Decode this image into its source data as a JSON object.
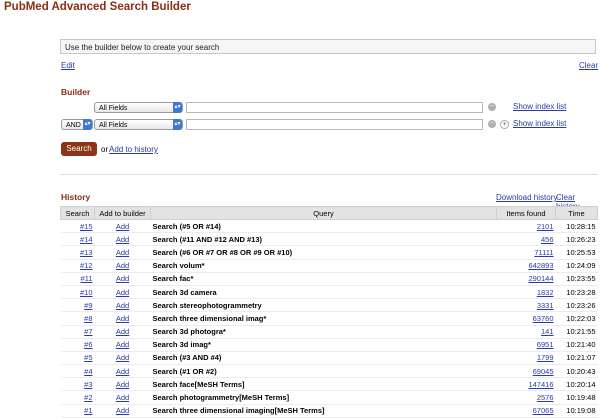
{
  "page": {
    "title": "PubMed Advanced Search Builder"
  },
  "query_box": {
    "placeholder": "Use the builder below to create your search"
  },
  "links": {
    "edit": "Edit",
    "clear": "Clear"
  },
  "builder": {
    "heading": "Builder",
    "rows": [
      {
        "field": "All Fields",
        "show_index": "Show index list"
      },
      {
        "op": "AND",
        "field": "All Fields",
        "show_index": "Show index list"
      }
    ],
    "search_label": "Search",
    "or_text": "or",
    "add_to_history": "Add to history"
  },
  "history": {
    "heading": "History",
    "download": "Download history",
    "clear": "Clear history",
    "columns": [
      "Search",
      "Add to builder",
      "Query",
      "Items found",
      "Time"
    ],
    "rows": [
      {
        "id": "#15",
        "add": "Add",
        "query": "Search (#5 OR #14)",
        "items": "2101",
        "time": "10:28:15"
      },
      {
        "id": "#14",
        "add": "Add",
        "query": "Search (#11 AND #12 AND #13)",
        "items": "456",
        "time": "10:26:23"
      },
      {
        "id": "#13",
        "add": "Add",
        "query": "Search (#6 OR #7 OR #8 OR #9 OR #10)",
        "items": "71111",
        "time": "10:25:53"
      },
      {
        "id": "#12",
        "add": "Add",
        "query": "Search volum*",
        "items": "642893",
        "time": "10:24:09"
      },
      {
        "id": "#11",
        "add": "Add",
        "query": "Search fac*",
        "items": "290144",
        "time": "10:23:55"
      },
      {
        "id": "#10",
        "add": "Add",
        "query": "Search 3d camera",
        "items": "1832",
        "time": "10:23:28"
      },
      {
        "id": "#9",
        "add": "Add",
        "query": "Search stereophotogrammetry",
        "items": "3331",
        "time": "10:23:26"
      },
      {
        "id": "#8",
        "add": "Add",
        "query": "Search three dimensional imag*",
        "items": "63760",
        "time": "10:22:03"
      },
      {
        "id": "#7",
        "add": "Add",
        "query": "Search 3d photogra*",
        "items": "141",
        "time": "10:21:55"
      },
      {
        "id": "#6",
        "add": "Add",
        "query": "Search 3d imag*",
        "items": "6951",
        "time": "10:21:40"
      },
      {
        "id": "#5",
        "add": "Add",
        "query": "Search (#3 AND #4)",
        "items": "1799",
        "time": "10:21:07"
      },
      {
        "id": "#4",
        "add": "Add",
        "query": "Search (#1 OR #2)",
        "items": "69045",
        "time": "10:20:43"
      },
      {
        "id": "#3",
        "add": "Add",
        "query": "Search face[MeSH Terms]",
        "items": "147416",
        "time": "10:20:14"
      },
      {
        "id": "#2",
        "add": "Add",
        "query": "Search photogrammetry[MeSH Terms]",
        "items": "2576",
        "time": "10:19:48"
      },
      {
        "id": "#1",
        "add": "Add",
        "query": "Search three dimensional imaging[MeSH Terms]",
        "items": "67065",
        "time": "10:19:08"
      }
    ]
  },
  "colors": {
    "brand": "#8b2e16",
    "link": "#2a3aa8",
    "select_arrow": "#3b78d8"
  }
}
